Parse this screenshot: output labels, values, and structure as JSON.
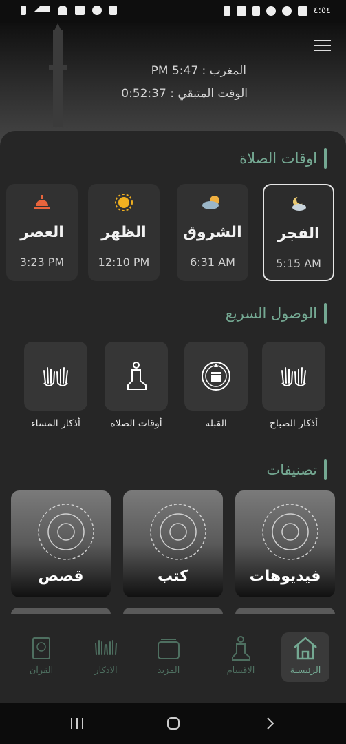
{
  "status_bar": {
    "time": "٤:٥٤",
    "left_icons": [
      "battery-icon",
      "signal-icon",
      "wifi-icon",
      "mute-icon",
      "alarm-icon",
      "shield-icon"
    ],
    "right_icons": [
      "download-icon",
      "image-icon",
      "lock-icon",
      "flower-icon",
      "flower-icon",
      "gallery-icon"
    ]
  },
  "header": {
    "maghrib_line": "المغرب : 5:47 PM",
    "remaining_line": "الوقت المتبقي : 0:52:37"
  },
  "prayer_times": {
    "section_title": "اوقات الصلاة",
    "items": [
      {
        "name": "الفجر",
        "time": "5:15 AM",
        "icon": "moon-cloud-icon",
        "active": true
      },
      {
        "name": "الشروق",
        "time": "6:31 AM",
        "icon": "sun-cloud-icon",
        "active": false
      },
      {
        "name": "الظهر",
        "time": "12:10 PM",
        "icon": "sun-icon",
        "active": false
      },
      {
        "name": "العصر",
        "time": "3:23 PM",
        "icon": "sunset-icon",
        "active": false
      }
    ]
  },
  "quick_access": {
    "section_title": "الوصول السريع",
    "items": [
      {
        "label": "أذكار الصباح",
        "icon": "praying-hands-icon"
      },
      {
        "label": "القبلة",
        "icon": "kaaba-compass-icon"
      },
      {
        "label": "أوقات الصلاة",
        "icon": "praying-person-icon"
      },
      {
        "label": "أذكار المساء",
        "icon": "praying-hands-icon"
      }
    ]
  },
  "categories": {
    "section_title": "تصنيفات",
    "items": [
      {
        "label": "فيديوهات"
      },
      {
        "label": "كتب"
      },
      {
        "label": "قصص"
      }
    ]
  },
  "bottom_nav": {
    "items": [
      {
        "label": "الرئيسية",
        "icon": "home-icon",
        "active": true
      },
      {
        "label": "الاقسام",
        "icon": "praying-person-icon",
        "active": false
      },
      {
        "label": "المزيد",
        "icon": "stack-icon",
        "active": false
      },
      {
        "label": "الاذكار",
        "icon": "praying-hands-icon",
        "active": false
      },
      {
        "label": "القرآن",
        "icon": "quran-book-icon",
        "active": false
      }
    ]
  },
  "system_nav": {
    "icons": [
      "recent-apps-icon",
      "home-circle-icon",
      "back-icon"
    ]
  },
  "colors": {
    "accent": "#74a892",
    "background": "#1c1c1c",
    "card": "#313131"
  }
}
